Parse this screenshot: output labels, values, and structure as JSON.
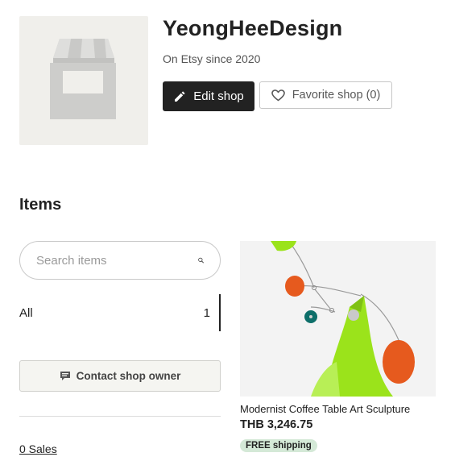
{
  "shop": {
    "name": "YeongHeeDesign",
    "since": "On Etsy since 2020",
    "edit_label": "Edit shop",
    "favorite_label": "Favorite shop (0)"
  },
  "items_section": {
    "heading": "Items",
    "search_placeholder": "Search items",
    "filters": [
      {
        "label": "All",
        "count": "1"
      }
    ],
    "contact_label": "Contact shop owner",
    "sales_link": "0 Sales"
  },
  "listings": [
    {
      "title": "Modernist Coffee Table Art Sculpture",
      "price": "THB 3,246.75",
      "badge": "FREE shipping"
    }
  ],
  "colors": {
    "primary_button": "#222222",
    "badge_bg": "#d4e9d7",
    "sculpture_green": "#9be31b",
    "sculpture_orange": "#e65a1e",
    "sculpture_teal": "#0e6f6a"
  },
  "icons": {
    "avatar": "storefront-icon",
    "edit": "pencil-icon",
    "favorite": "heart-icon",
    "search": "search-icon",
    "contact": "message-icon"
  }
}
